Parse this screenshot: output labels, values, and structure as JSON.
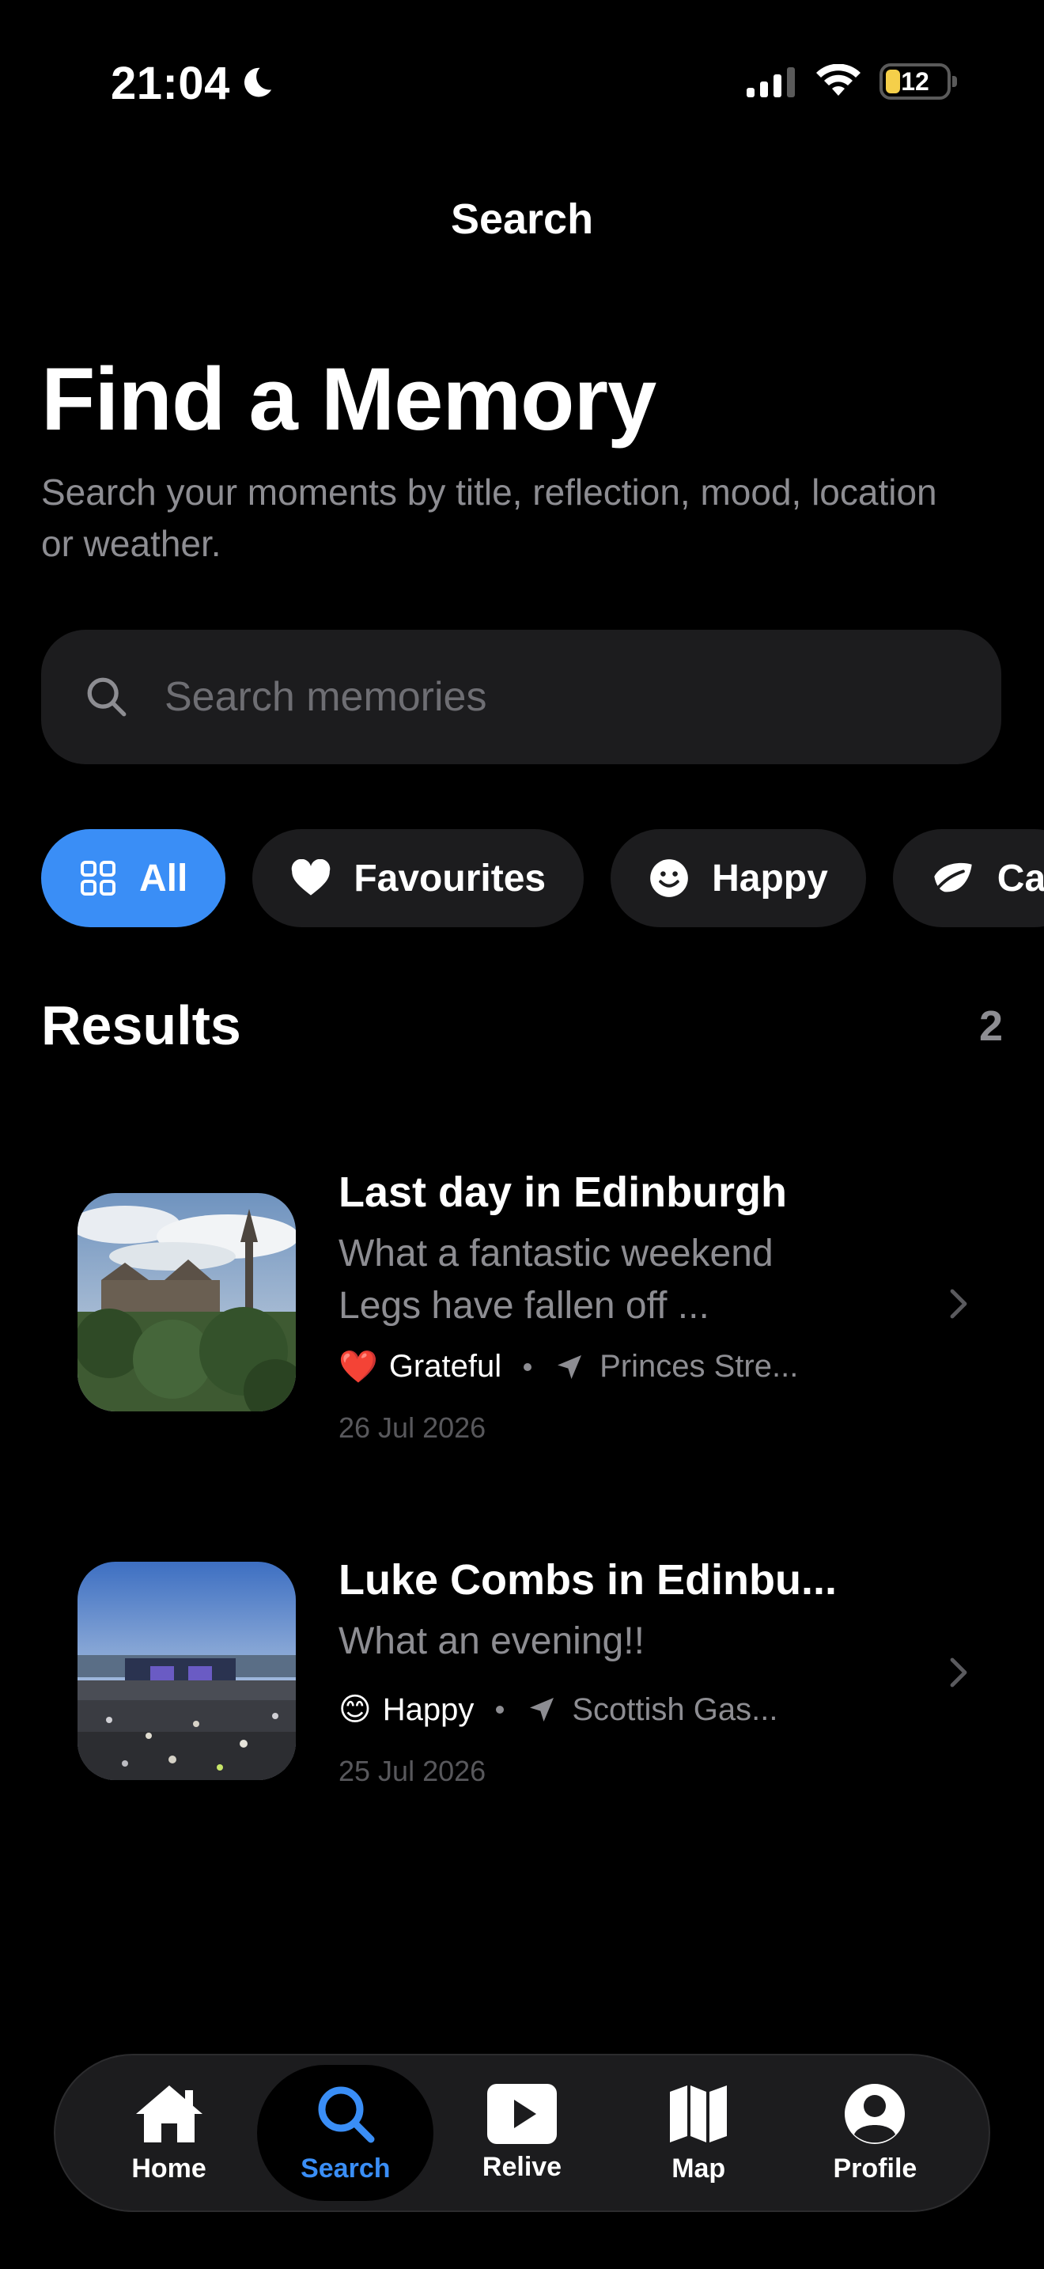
{
  "status": {
    "time": "21:04",
    "battery": "12"
  },
  "nav": {
    "title": "Search"
  },
  "hero": {
    "title": "Find a Memory",
    "subtitle": "Search your moments by title, reflection, mood, location or weather."
  },
  "search": {
    "placeholder": "Search memories",
    "value": ""
  },
  "chips": [
    {
      "label": "All",
      "icon": "grid-icon",
      "active": true
    },
    {
      "label": "Favourites",
      "icon": "heart-icon",
      "active": false
    },
    {
      "label": "Happy",
      "icon": "smiley-icon",
      "active": false
    },
    {
      "label": "Ca",
      "icon": "leaf-icon",
      "active": false
    }
  ],
  "results": {
    "title": "Results",
    "count": "2",
    "items": [
      {
        "title": "Last day in Edinburgh",
        "body_line1": "What a fantastic weekend",
        "body_line2": "Legs have fallen off ...",
        "mood_emoji": "❤️",
        "mood": "Grateful",
        "location": "Princes Stre...",
        "date": "26 Jul 2026"
      },
      {
        "title": "Luke Combs in Edinbu...",
        "body_line1": "What an evening!!",
        "mood_emoji": "😊",
        "mood": "Happy",
        "location": "Scottish Gas...",
        "date": "25 Jul 2026"
      }
    ]
  },
  "tabs": [
    {
      "label": "Home",
      "icon": "house-icon"
    },
    {
      "label": "Search",
      "icon": "search-icon",
      "active": true
    },
    {
      "label": "Relive",
      "icon": "play-icon"
    },
    {
      "label": "Map",
      "icon": "map-icon"
    },
    {
      "label": "Profile",
      "icon": "person-icon"
    }
  ],
  "colors": {
    "accent": "#3a8ef6",
    "background": "#000000",
    "surface": "#1c1c1e",
    "muted": "#8d8d92"
  }
}
